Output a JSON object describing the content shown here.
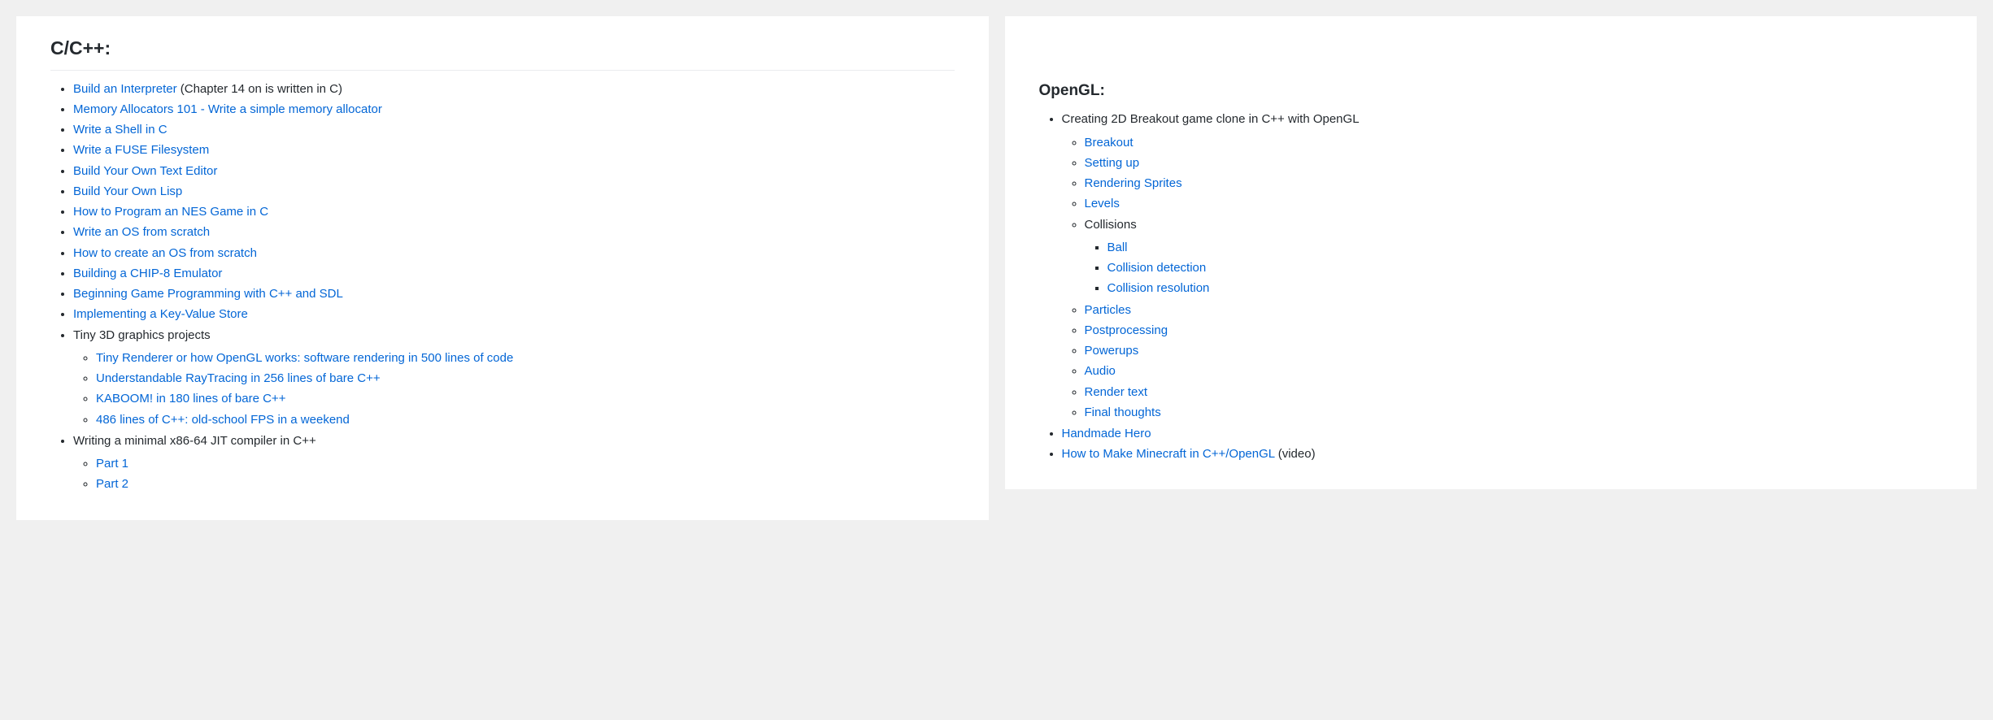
{
  "left": {
    "title": "C/C++:",
    "items": [
      {
        "type": "link-with-suffix",
        "link": "Build an Interpreter",
        "suffix": " (Chapter 14 on is written in C)"
      },
      {
        "type": "link",
        "link": "Memory Allocators 101 - Write a simple memory allocator"
      },
      {
        "type": "link",
        "link": "Write a Shell in C"
      },
      {
        "type": "link",
        "link": "Write a FUSE Filesystem"
      },
      {
        "type": "link",
        "link": "Build Your Own Text Editor"
      },
      {
        "type": "link",
        "link": "Build Your Own Lisp"
      },
      {
        "type": "link",
        "link": "How to Program an NES Game in C"
      },
      {
        "type": "link",
        "link": "Write an OS from scratch"
      },
      {
        "type": "link",
        "link": "How to create an OS from scratch"
      },
      {
        "type": "link",
        "link": "Building a CHIP-8 Emulator"
      },
      {
        "type": "link",
        "link": "Beginning Game Programming with C++ and SDL"
      },
      {
        "type": "link",
        "link": "Implementing a Key-Value Store"
      },
      {
        "type": "text-with-children",
        "text": "Tiny 3D graphics projects",
        "children": [
          {
            "type": "link",
            "link": "Tiny Renderer or how OpenGL works: software rendering in 500 lines of code"
          },
          {
            "type": "link",
            "link": "Understandable RayTracing in 256 lines of bare C++"
          },
          {
            "type": "link",
            "link": "KABOOM! in 180 lines of bare C++"
          },
          {
            "type": "link",
            "link": "486 lines of C++: old-school FPS in a weekend"
          }
        ]
      },
      {
        "type": "text-with-children",
        "text": "Writing a minimal x86-64 JIT compiler in C++",
        "children": [
          {
            "type": "link",
            "link": "Part 1"
          },
          {
            "type": "link",
            "link": "Part 2"
          }
        ]
      }
    ]
  },
  "right": {
    "title": "OpenGL:",
    "items": [
      {
        "type": "text-with-children",
        "text": "Creating 2D Breakout game clone in C++ with OpenGL",
        "children": [
          {
            "type": "link",
            "link": "Breakout"
          },
          {
            "type": "link",
            "link": "Setting up"
          },
          {
            "type": "link",
            "link": "Rendering Sprites"
          },
          {
            "type": "link",
            "link": "Levels"
          },
          {
            "type": "text-with-children",
            "text": "Collisions",
            "children": [
              {
                "type": "link",
                "link": "Ball"
              },
              {
                "type": "link",
                "link": "Collision detection"
              },
              {
                "type": "link",
                "link": "Collision resolution"
              }
            ]
          },
          {
            "type": "link",
            "link": "Particles"
          },
          {
            "type": "link",
            "link": "Postprocessing"
          },
          {
            "type": "link",
            "link": "Powerups"
          },
          {
            "type": "link",
            "link": "Audio"
          },
          {
            "type": "link",
            "link": "Render text"
          },
          {
            "type": "link",
            "link": "Final thoughts"
          }
        ]
      },
      {
        "type": "link",
        "link": "Handmade Hero"
      },
      {
        "type": "link-with-suffix",
        "link": "How to Make Minecraft in C++/OpenGL",
        "suffix": " (video)"
      }
    ]
  }
}
